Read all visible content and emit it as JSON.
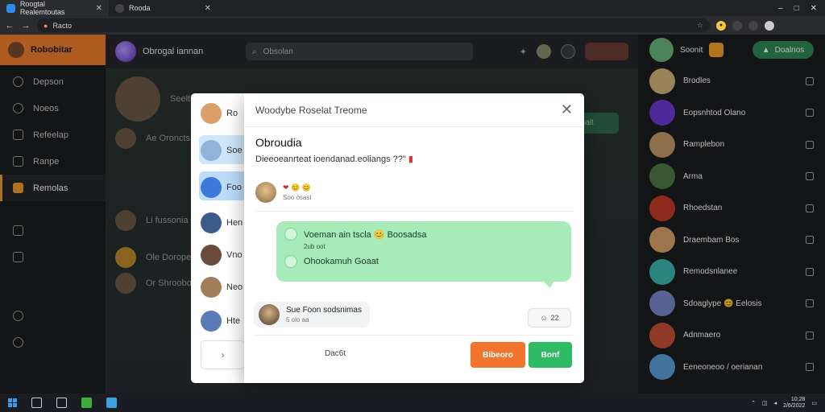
{
  "browser": {
    "tabs": [
      {
        "title": "Roogtal Realemtoutas",
        "active": true
      },
      {
        "title": "Rooda",
        "active": false
      }
    ],
    "omnibox_text": "Racto"
  },
  "sidebar": {
    "header": "Robobitar",
    "items": [
      {
        "label": "Depson",
        "icon": "clock-icon"
      },
      {
        "label": "Noeos",
        "icon": "message-icon"
      },
      {
        "label": "Refeelap",
        "icon": "tag-icon"
      },
      {
        "label": "Ranpe",
        "icon": "folder-icon"
      },
      {
        "label": "Remolas",
        "icon": "folder-icon",
        "active": true
      }
    ]
  },
  "main": {
    "title": "Obrogal iannan",
    "search_placeholder": "Obsolan",
    "bg_rows": [
      "Seeltiblots",
      "Ae Oroncts",
      "Li fussonia",
      "Ole Doropeo",
      "Or Shroobo"
    ],
    "bg_button": "Hacl Tanait"
  },
  "modal": {
    "header": "Woodybe Roselat Treome",
    "title": "Obroudia",
    "subtitle": "Dieeoeanrteat ioendanad.eoliangs ??\"",
    "sender_time": "Soo osast",
    "bubble_lines": [
      {
        "text": "Voeman ain tscla 😊 Boosadsa",
        "sub": "2ub oot"
      },
      {
        "text": "Ohookamuh Goaat",
        "sub": ""
      }
    ],
    "reply_name": "Sue Foon sodsnimas",
    "reply_sub": "5 olo aa",
    "count_label": "22",
    "cancel_label": "Dac6t",
    "primary_label": "Bibeoro",
    "secondary_label": "Bonf",
    "list": [
      {
        "name": "Ro",
        "color": "#d9a06a"
      },
      {
        "name": "Soe",
        "color": "#8fb4d8"
      },
      {
        "name": "Foo",
        "color": "#3d7ad8"
      },
      {
        "name": "Hen",
        "color": "#3b5c8a"
      },
      {
        "name": "Vno",
        "color": "#6b4c3b"
      },
      {
        "name": "Neo",
        "color": "#a47e5a"
      },
      {
        "name": "Hte",
        "color": "#5a7ab8"
      }
    ]
  },
  "right_panel": {
    "header_name": "Soonit",
    "header_button": "Doalnos",
    "contacts": [
      {
        "name": "Brodles",
        "color": "#d7b67c"
      },
      {
        "name": "Eopsnhtod Olano",
        "color": "#6a3bd1"
      },
      {
        "name": "Ramplebon",
        "color": "#c59a6a"
      },
      {
        "name": "Arma",
        "color": "#4d7a45"
      },
      {
        "name": "Rhoedstan",
        "color": "#c23b2a"
      },
      {
        "name": "Draembam Bos",
        "color": "#d9a36b"
      },
      {
        "name": "Remodsnlanee",
        "color": "#3cb7b0"
      },
      {
        "name": "Sdoaglype 😊 Eelosis",
        "color": "#7a88c9"
      },
      {
        "name": "Adnmaero",
        "color": "#c9503a"
      },
      {
        "name": "Eeneoneoo / oerianan",
        "color": "#5aa0d8"
      }
    ]
  },
  "taskbar": {
    "time": "10:28",
    "date": "2/6/2022"
  }
}
